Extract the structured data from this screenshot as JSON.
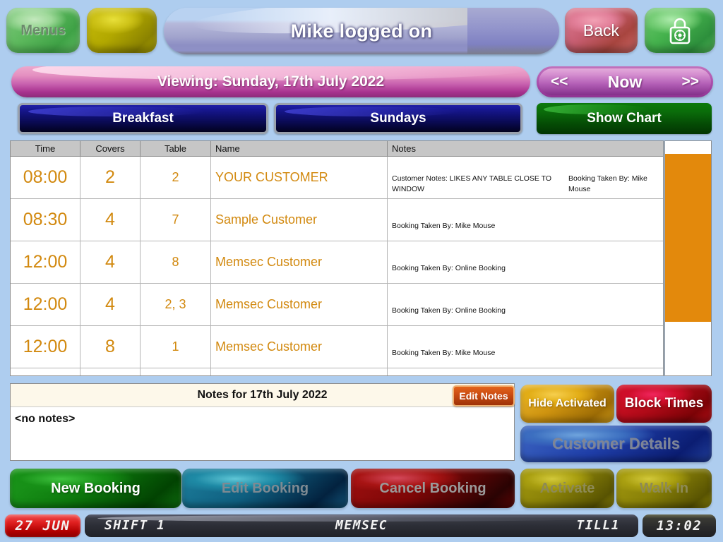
{
  "header": {
    "menus_label": "Menus",
    "blank_button_label": "",
    "title": "Mike logged on",
    "back_label": "Back",
    "lock_icon": "padlock-combination-icon"
  },
  "datebar": {
    "viewing_label": "Viewing: Sunday, 17th July 2022",
    "nav_prev": "<<",
    "nav_now": "Now",
    "nav_next": ">>"
  },
  "tabs": {
    "breakfast": "Breakfast",
    "sundays": "Sundays",
    "show_chart": "Show Chart"
  },
  "grid": {
    "columns": [
      "Time",
      "Covers",
      "Table",
      "Name",
      "Notes"
    ],
    "rows": [
      {
        "time": "08:00",
        "covers": "2",
        "table": "2",
        "name": "YOUR CUSTOMER",
        "note1": "Customer Notes: LIKES ANY TABLE CLOSE TO WINDOW",
        "note2": "Booking Taken By: Mike Mouse"
      },
      {
        "time": "08:30",
        "covers": "4",
        "table": "7",
        "name": "Sample Customer",
        "note1": "Booking Taken By: Mike Mouse",
        "note2": ""
      },
      {
        "time": "12:00",
        "covers": "4",
        "table": "8",
        "name": "Memsec Customer",
        "note1": "Booking Taken By: Online Booking",
        "note2": ""
      },
      {
        "time": "12:00",
        "covers": "4",
        "table": "2, 3",
        "name": "Memsec Customer",
        "note1": "Booking Taken By: Online Booking",
        "note2": ""
      },
      {
        "time": "12:00",
        "covers": "8",
        "table": "1",
        "name": "Memsec Customer",
        "note1": "Booking Taken By: Mike Mouse",
        "note2": ""
      },
      {
        "time": "",
        "covers": "",
        "table": "",
        "name": "",
        "note1": "",
        "note2": ""
      }
    ]
  },
  "notes_panel": {
    "title": "Notes for 17th July 2022",
    "body": "<no notes>",
    "edit_label": "Edit Notes"
  },
  "actions": {
    "hide_activated": "Hide Activated",
    "block_times": "Block Times",
    "customer_details": "Customer Details",
    "new_booking": "New Booking",
    "edit_booking": "Edit Booking",
    "cancel_booking": "Cancel Booking",
    "activate": "Activate",
    "walk_in": "Walk In"
  },
  "statusbar": {
    "date": "27 JUN",
    "shift": "SHIFT 1",
    "venue": "MEMSEC",
    "till": "TILL1",
    "time": "13:02"
  },
  "colors": {
    "background": "#aecdef",
    "grid_text": "#d2890f",
    "scrollbar_thumb": "#e3890c",
    "header_row": "#c6c6c6"
  }
}
